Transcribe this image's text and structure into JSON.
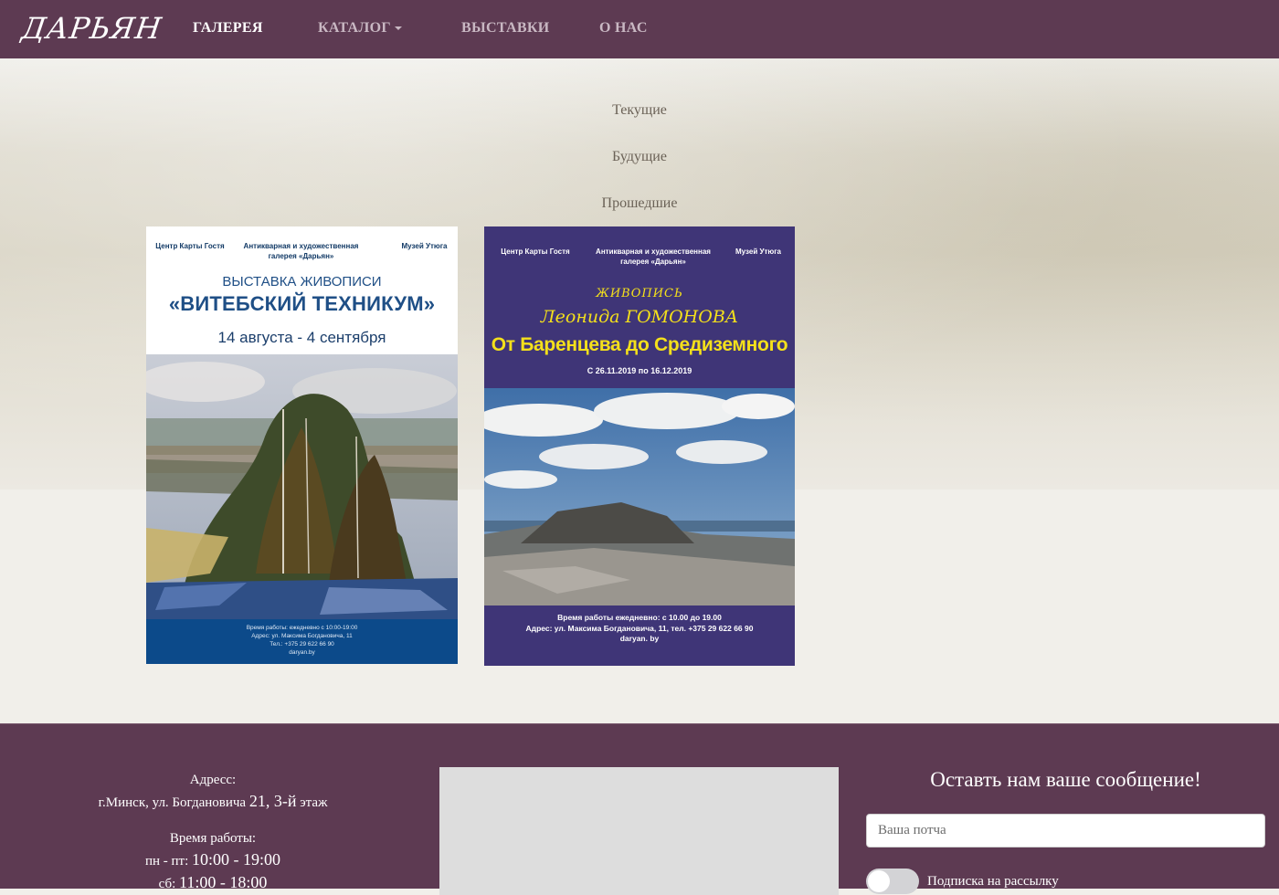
{
  "brand": {
    "logo_text": "ДАРЬЯН"
  },
  "nav": {
    "items": [
      {
        "label": "ГАЛЕРЕЯ"
      },
      {
        "label": "КАТАЛОГ"
      },
      {
        "label": "ВЫСТАВКИ"
      },
      {
        "label": "О НАС"
      }
    ]
  },
  "filters": {
    "items": [
      {
        "label": "Текущие"
      },
      {
        "label": "Будущие"
      },
      {
        "label": "Прошедшие"
      }
    ]
  },
  "posters": [
    {
      "org_left": "Центр Карты Гостя",
      "org_center": "Антикварная и художественная галерея «Дарьян»",
      "org_right": "Музей Утюга",
      "subtitle": "ВЫСТАВКА ЖИВОПИСИ",
      "title": "«ВИТЕБСКИЙ ТЕХНИКУМ»",
      "dates": "14 августа - 4 сентября",
      "footer_lines": [
        "Время работы: ежедневно с 10:00-19:00",
        "Адрес: ул. Максима Богдановича, 11",
        "Тел.: +375 29 622 66 90",
        "daryan.by"
      ]
    },
    {
      "org_left": "Центр Карты Гостя",
      "org_center": "Антикварная и художественная галерея «Дарьян»",
      "org_right": "Музей Утюга",
      "genre": "ЖИВОПИСЬ",
      "artist": "Леонида ГОМОНОВА",
      "title": "От Баренцева до Средиземного",
      "dates": "С 26.11.2019 по 16.12.2019",
      "footer_lines": [
        "Время работы ежедневно: с 10.00 до 19.00",
        "Адрес: ул. Максима Богдановича, 11, тел. +375 29 622 66 90",
        "daryan. by"
      ]
    }
  ],
  "footer": {
    "address_label": "Адресс:",
    "address_value_prefix": "г.Минск, ул. Богдановича",
    "address_value_number": "21, 3-й",
    "address_value_suffix": "этаж",
    "hours_label": "Время работы:",
    "hours_weekdays_label": "пн - пт:",
    "hours_weekdays_value": "10:00 - 19:00",
    "hours_saturday_label": "сб:",
    "hours_saturday_value": "11:00 - 18:00",
    "form_title": "Оставть нам ваше сообщение!",
    "email_placeholder": "Ваша потча",
    "subscribe_label": "Подписка на рассылку"
  },
  "colors": {
    "nav_bg": "#5d3a52",
    "poster2_bg": "#3f3577",
    "poster_accent_yellow": "#f4e01b"
  }
}
